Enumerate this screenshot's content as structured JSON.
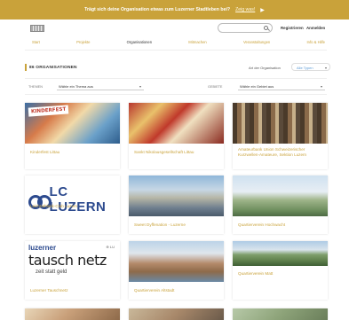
{
  "banner": {
    "text": "Trägt sich deine Organisation etwas zum Luzerner Stadtleben bei?",
    "link": "Zeig was!",
    "arrow_icon": "▶"
  },
  "header": {
    "search_placeholder": "",
    "register": "Registrieren",
    "login": "Anmelden"
  },
  "nav": {
    "items": [
      "Start",
      "Projekte",
      "Organisationen",
      "Mitmachen",
      "Veranstaltungen",
      "Info & Hilfe"
    ],
    "active_index": 2
  },
  "section": {
    "title": "86 ORGANISATIONEN",
    "type_label": "Art der Organisation",
    "type_value": "Alle Typen",
    "chevron": "▾"
  },
  "filters": {
    "theme_label": "THEMEN",
    "theme_value": "Wähle ein Thema aus",
    "area_label": "GEBIETE",
    "area_value": "Wähle ein Gebiet aus",
    "chevron": "▾"
  },
  "cards": [
    {
      "name": "Kinderfest Littau",
      "logo": "KINDERFEST"
    },
    {
      "name": "Sankt Nikolausgesellschaft Littau"
    },
    {
      "name": "Amateurbank Union Schweizerischer Kurzwellen-Amateure, Sektion Luzern"
    },
    {
      "name": "Leichtathletik-Club Luzern",
      "logo": "LC LUZERN"
    },
    {
      "name": "Sweet Dyffenation - Luzerne"
    },
    {
      "name": "Quartierverein Hochwacht"
    },
    {
      "name": "Luzerner Tauschnetz",
      "logo_top": "luzerner",
      "logo_main": "tausch netz",
      "logo_sub": "zeit statt geld",
      "logo_badge": "⊕ LU"
    },
    {
      "name": "Quartierverein Altstadt"
    },
    {
      "name": "Quartierverein Matt"
    }
  ]
}
